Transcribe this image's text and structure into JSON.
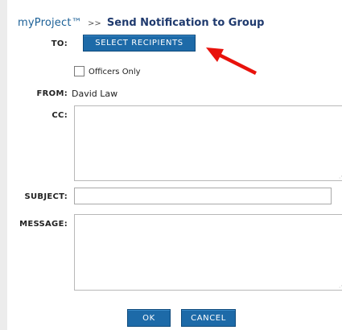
{
  "header": {
    "brand": "myProject™",
    "separator": ">>",
    "title": "Send Notification to Group"
  },
  "form": {
    "to_label": "TO:",
    "select_recipients_label": "SELECT RECIPIENTS",
    "officers_only_label": "Officers Only",
    "officers_only_checked": false,
    "from_label": "FROM:",
    "from_value": "David Law",
    "cc_label": "CC:",
    "cc_value": "",
    "subject_label": "SUBJECT:",
    "subject_value": "",
    "message_label": "MESSAGE:",
    "message_value": ""
  },
  "actions": {
    "ok_label": "OK",
    "cancel_label": "CANCEL"
  },
  "colors": {
    "brand": "#1a5f96",
    "title": "#1f3a6e",
    "button": "#1d6aa8",
    "arrow": "#e8120c"
  },
  "annotation": {
    "arrow_icon": "red-arrow-icon"
  }
}
